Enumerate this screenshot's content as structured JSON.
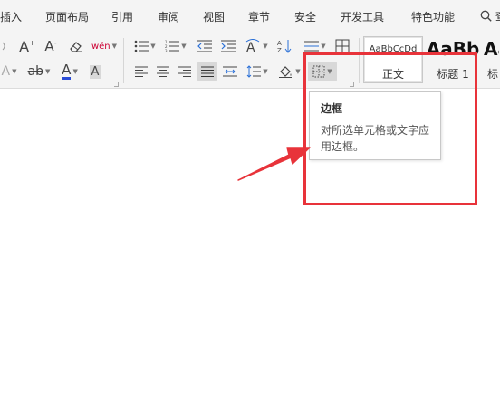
{
  "menu": {
    "items": [
      "插入",
      "页面布局",
      "引用",
      "审阅",
      "视图",
      "章节",
      "安全",
      "开发工具",
      "特色功能"
    ],
    "search_label": "查"
  },
  "ribbon": {
    "font_group": {
      "bold_a_label": "A",
      "shrink_a_label": "A",
      "font_color_label": "A",
      "char_shading_label": "A",
      "highlight_label": "A",
      "strike_label": "ab",
      "phonetic_label": "wén"
    },
    "styles": [
      {
        "sample": "AaBbCcDd",
        "name": "正文"
      },
      {
        "sample": "AaBb",
        "name": "标题 1"
      },
      {
        "sample": "Aa",
        "name": "标"
      }
    ]
  },
  "tooltip": {
    "title": "边框",
    "body": "对所选单元格或文字应用边框。"
  },
  "colors": {
    "annotation": "#e8333a",
    "font_color_bar": "#2a4cd6",
    "ribbon_bg": "#f4f4f4"
  }
}
